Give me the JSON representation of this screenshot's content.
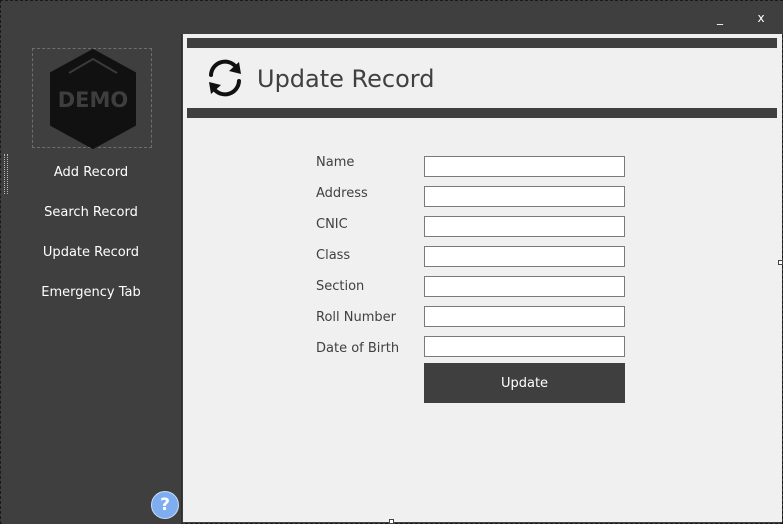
{
  "window": {
    "minimize_label": "_",
    "close_label": "x"
  },
  "sidebar": {
    "logo_text": "DEMO",
    "items": [
      {
        "label": "Add Record"
      },
      {
        "label": "Search Record"
      },
      {
        "label": "Update Record"
      },
      {
        "label": "Emergency Tab"
      }
    ],
    "help_label": "?"
  },
  "main": {
    "title": "Update Record",
    "icon": "refresh-icon",
    "form": {
      "fields": [
        {
          "label": "Name",
          "value": ""
        },
        {
          "label": "Address",
          "value": ""
        },
        {
          "label": "CNIC",
          "value": ""
        },
        {
          "label": "Class",
          "value": ""
        },
        {
          "label": "Section",
          "value": ""
        },
        {
          "label": "Roll Number",
          "value": ""
        },
        {
          "label": "Date of Birth",
          "value": ""
        }
      ],
      "submit_label": "Update"
    }
  },
  "colors": {
    "sidebar_bg": "#3f3f3f",
    "content_bg": "#f0f0f0",
    "accent_bar": "#3f3f3f",
    "help_button": "#7eaef0",
    "text_dark": "#404040",
    "text_light": "#ffffff"
  }
}
